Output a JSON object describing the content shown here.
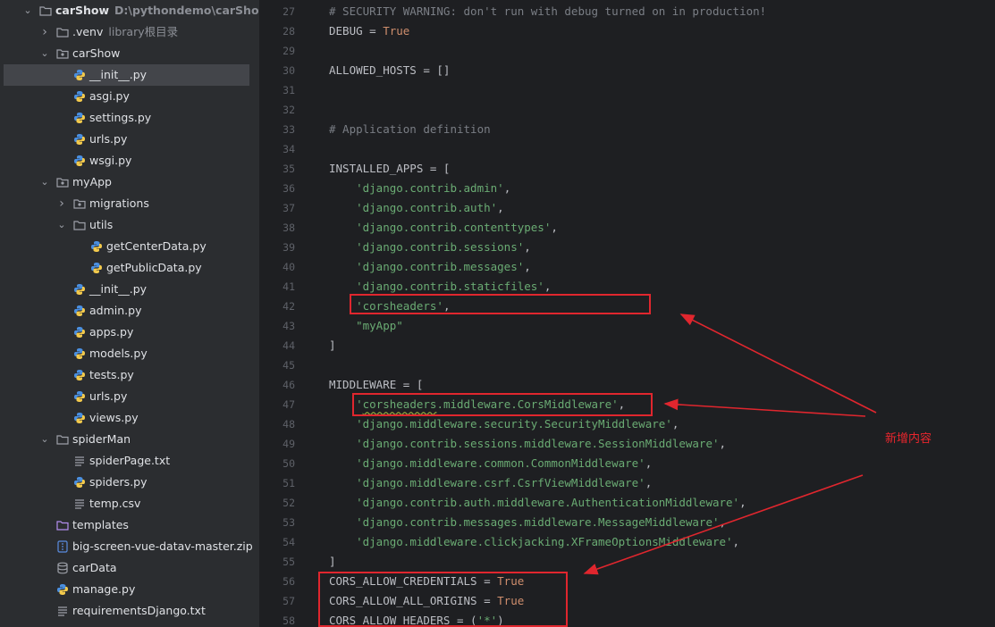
{
  "project_tree": {
    "root": {
      "name": "carShow",
      "path": "D:\\pythondemo\\carShow"
    },
    "items": [
      {
        "label": "carShow",
        "hint": "D:\\pythondemo\\carShow",
        "icon": "folder-icon",
        "expanded": true,
        "selected": false
      },
      {
        "label": ".venv",
        "hint": "library根目录",
        "icon": "folder-icon",
        "expanded": false,
        "selected": false
      },
      {
        "label": "carShow",
        "hint": "",
        "icon": "package-icon",
        "expanded": true,
        "selected": false
      },
      {
        "label": "__init__.py",
        "hint": "",
        "icon": "python-file-icon",
        "selected": true
      },
      {
        "label": "asgi.py",
        "hint": "",
        "icon": "python-file-icon",
        "selected": false
      },
      {
        "label": "settings.py",
        "hint": "",
        "icon": "python-file-icon",
        "selected": false
      },
      {
        "label": "urls.py",
        "hint": "",
        "icon": "python-file-icon",
        "selected": false
      },
      {
        "label": "wsgi.py",
        "hint": "",
        "icon": "python-file-icon",
        "selected": false
      },
      {
        "label": "myApp",
        "hint": "",
        "icon": "package-icon",
        "expanded": true,
        "selected": false
      },
      {
        "label": "migrations",
        "hint": "",
        "icon": "package-icon",
        "expanded": false,
        "selected": false
      },
      {
        "label": "utils",
        "hint": "",
        "icon": "folder-icon",
        "expanded": true,
        "selected": false
      },
      {
        "label": "getCenterData.py",
        "hint": "",
        "icon": "python-file-icon",
        "selected": false
      },
      {
        "label": "getPublicData.py",
        "hint": "",
        "icon": "python-file-icon",
        "selected": false
      },
      {
        "label": "__init__.py",
        "hint": "",
        "icon": "python-file-icon",
        "selected": false
      },
      {
        "label": "admin.py",
        "hint": "",
        "icon": "python-file-icon",
        "selected": false
      },
      {
        "label": "apps.py",
        "hint": "",
        "icon": "python-file-icon",
        "selected": false
      },
      {
        "label": "models.py",
        "hint": "",
        "icon": "python-file-icon",
        "selected": false
      },
      {
        "label": "tests.py",
        "hint": "",
        "icon": "python-file-icon",
        "selected": false
      },
      {
        "label": "urls.py",
        "hint": "",
        "icon": "python-file-icon",
        "selected": false
      },
      {
        "label": "views.py",
        "hint": "",
        "icon": "python-file-icon",
        "selected": false
      },
      {
        "label": "spiderMan",
        "hint": "",
        "icon": "folder-icon",
        "expanded": true,
        "selected": false
      },
      {
        "label": "spiderPage.txt",
        "hint": "",
        "icon": "text-file-icon",
        "selected": false
      },
      {
        "label": "spiders.py",
        "hint": "",
        "icon": "python-file-icon",
        "selected": false
      },
      {
        "label": "temp.csv",
        "hint": "",
        "icon": "text-file-icon",
        "selected": false
      },
      {
        "label": "templates",
        "hint": "",
        "icon": "templates-folder-icon",
        "selected": false
      },
      {
        "label": "big-screen-vue-datav-master.zip",
        "hint": "",
        "icon": "zip-file-icon",
        "selected": false
      },
      {
        "label": "carData",
        "hint": "",
        "icon": "database-icon",
        "selected": false
      },
      {
        "label": "manage.py",
        "hint": "",
        "icon": "python-file-icon",
        "selected": false
      },
      {
        "label": "requirementsDjango.txt",
        "hint": "",
        "icon": "text-file-icon",
        "selected": false
      }
    ]
  },
  "editor": {
    "line_numbers": [
      "27",
      "28",
      "29",
      "30",
      "31",
      "32",
      "33",
      "34",
      "35",
      "36",
      "37",
      "38",
      "39",
      "40",
      "41",
      "42",
      "43",
      "44",
      "45",
      "46",
      "47",
      "48",
      "49",
      "50",
      "51",
      "52",
      "53",
      "54",
      "55",
      "56",
      "57",
      "58"
    ],
    "lines": [
      [
        {
          "t": "# SECURITY WARNING: don't run with debug turned on in production!",
          "c": "comment"
        }
      ],
      [
        {
          "t": "DEBUG",
          "c": "id"
        },
        {
          "t": " = ",
          "c": "id"
        },
        {
          "t": "True",
          "c": "kw"
        }
      ],
      [],
      [
        {
          "t": "ALLOWED_HOSTS = []",
          "c": "id"
        }
      ],
      [],
      [],
      [
        {
          "t": "# Application definition",
          "c": "comment"
        }
      ],
      [],
      [
        {
          "t": "INSTALLED_APPS = [",
          "c": "id"
        }
      ],
      [
        {
          "t": "    ",
          "c": "id"
        },
        {
          "t": "'django.contrib.admin'",
          "c": "str"
        },
        {
          "t": ",",
          "c": "id"
        }
      ],
      [
        {
          "t": "    ",
          "c": "id"
        },
        {
          "t": "'django.contrib.auth'",
          "c": "str"
        },
        {
          "t": ",",
          "c": "id"
        }
      ],
      [
        {
          "t": "    ",
          "c": "id"
        },
        {
          "t": "'django.contrib.contenttypes'",
          "c": "str"
        },
        {
          "t": ",",
          "c": "id"
        }
      ],
      [
        {
          "t": "    ",
          "c": "id"
        },
        {
          "t": "'django.contrib.sessions'",
          "c": "str"
        },
        {
          "t": ",",
          "c": "id"
        }
      ],
      [
        {
          "t": "    ",
          "c": "id"
        },
        {
          "t": "'django.contrib.messages'",
          "c": "str"
        },
        {
          "t": ",",
          "c": "id"
        }
      ],
      [
        {
          "t": "    ",
          "c": "id"
        },
        {
          "t": "'django.contrib.staticfiles'",
          "c": "str"
        },
        {
          "t": ",",
          "c": "id"
        }
      ],
      [
        {
          "t": "    ",
          "c": "id"
        },
        {
          "t": "'corsheaders'",
          "c": "str"
        },
        {
          "t": ",",
          "c": "id"
        }
      ],
      [
        {
          "t": "    ",
          "c": "id"
        },
        {
          "t": "\"myApp\"",
          "c": "str"
        }
      ],
      [
        {
          "t": "]",
          "c": "id"
        }
      ],
      [],
      [
        {
          "t": "MIDDLEWARE = [",
          "c": "id"
        }
      ],
      [
        {
          "t": "    ",
          "c": "id"
        },
        {
          "t": "'",
          "c": "str"
        },
        {
          "t": "corsheaders",
          "c": "str-wavy"
        },
        {
          "t": ".middleware.CorsMiddleware'",
          "c": "str"
        },
        {
          "t": ",",
          "c": "id"
        }
      ],
      [
        {
          "t": "    ",
          "c": "id"
        },
        {
          "t": "'django.middleware.security.SecurityMiddleware'",
          "c": "str"
        },
        {
          "t": ",",
          "c": "id"
        }
      ],
      [
        {
          "t": "    ",
          "c": "id"
        },
        {
          "t": "'django.contrib.sessions.middleware.SessionMiddleware'",
          "c": "str"
        },
        {
          "t": ",",
          "c": "id"
        }
      ],
      [
        {
          "t": "    ",
          "c": "id"
        },
        {
          "t": "'django.middleware.common.CommonMiddleware'",
          "c": "str"
        },
        {
          "t": ",",
          "c": "id"
        }
      ],
      [
        {
          "t": "    ",
          "c": "id"
        },
        {
          "t": "'django.middleware.csrf.CsrfViewMiddleware'",
          "c": "str"
        },
        {
          "t": ",",
          "c": "id"
        }
      ],
      [
        {
          "t": "    ",
          "c": "id"
        },
        {
          "t": "'django.contrib.auth.middleware.AuthenticationMiddleware'",
          "c": "str"
        },
        {
          "t": ",",
          "c": "id"
        }
      ],
      [
        {
          "t": "    ",
          "c": "id"
        },
        {
          "t": "'django.contrib.messages.middleware.MessageMiddleware'",
          "c": "str"
        },
        {
          "t": ",",
          "c": "id"
        }
      ],
      [
        {
          "t": "    ",
          "c": "id"
        },
        {
          "t": "'django.middleware.clickjacking.XFrameOptionsMiddleware'",
          "c": "str"
        },
        {
          "t": ",",
          "c": "id"
        }
      ],
      [
        {
          "t": "]",
          "c": "id"
        }
      ],
      [
        {
          "t": "CORS_ALLOW_CREDENTIALS = ",
          "c": "id"
        },
        {
          "t": "True",
          "c": "kw"
        }
      ],
      [
        {
          "t": "CORS_ALLOW_ALL_ORIGINS = ",
          "c": "id"
        },
        {
          "t": "True",
          "c": "kw"
        }
      ],
      [
        {
          "t": "CORS_ALLOW_HEADERS = (",
          "c": "id"
        },
        {
          "t": "'*'",
          "c": "str"
        },
        {
          "t": ")",
          "c": "id"
        }
      ]
    ]
  },
  "annotation": {
    "note": "新增内容",
    "color": "#e0262e"
  },
  "colors": {
    "sidebar_bg": "#2b2d30",
    "editor_bg": "#1e1f22",
    "comment": "#7a7e85",
    "keyword": "#cf8e6d",
    "string": "#6aab73"
  }
}
